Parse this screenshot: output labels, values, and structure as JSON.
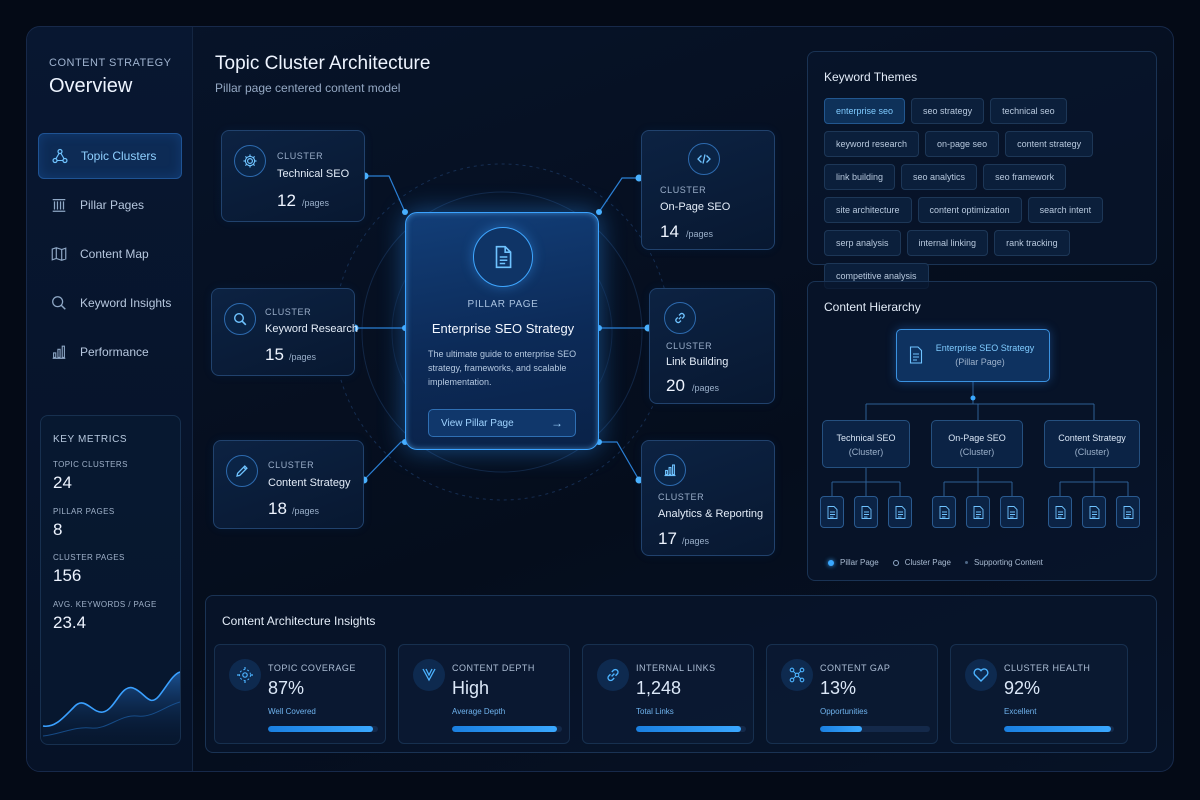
{
  "sidebar": {
    "kicker": "CONTENT STRATEGY",
    "title": "Overview",
    "nav": [
      {
        "label": "Topic Clusters",
        "icon": "hub-icon",
        "active": true
      },
      {
        "label": "Pillar Pages",
        "icon": "pillar-icon",
        "active": false
      },
      {
        "label": "Content Map",
        "icon": "map-icon",
        "active": false
      },
      {
        "label": "Keyword Insights",
        "icon": "search-icon",
        "active": false
      },
      {
        "label": "Performance",
        "icon": "bar-chart-icon",
        "active": false
      }
    ],
    "metrics": {
      "title": "KEY METRICS",
      "items": [
        {
          "label": "TOPIC CLUSTERS",
          "value": "24"
        },
        {
          "label": "PILLAR PAGES",
          "value": "8"
        },
        {
          "label": "CLUSTER PAGES",
          "value": "156"
        },
        {
          "label": "AVG. KEYWORDS / PAGE",
          "value": "23.4"
        }
      ]
    }
  },
  "header": {
    "title": "Topic Cluster Architecture",
    "subtitle": "Pillar page centered content model"
  },
  "pillar": {
    "kicker": "PILLAR PAGE",
    "title": "Enterprise SEO Strategy",
    "description": "The ultimate guide to enterprise SEO strategy, frameworks, and scalable implementation.",
    "button_label": "View Pillar Page",
    "button_arrow": "→"
  },
  "clusters": [
    {
      "kicker": "CLUSTER",
      "name": "Technical SEO",
      "pages": "12",
      "unit": "/pages",
      "icon": "gear-icon"
    },
    {
      "kicker": "CLUSTER",
      "name": "Keyword Research",
      "pages": "15",
      "unit": "/pages",
      "icon": "search-icon"
    },
    {
      "kicker": "CLUSTER",
      "name": "Content Strategy",
      "pages": "18",
      "unit": "/pages",
      "icon": "pencil-icon"
    },
    {
      "kicker": "CLUSTER",
      "name": "On-Page SEO",
      "pages": "14",
      "unit": "/pages",
      "icon": "code-icon"
    },
    {
      "kicker": "CLUSTER",
      "name": "Link Building",
      "pages": "20",
      "unit": "/pages",
      "icon": "link-icon"
    },
    {
      "kicker": "CLUSTER",
      "name": "Analytics & Reporting",
      "pages": "17",
      "unit": "/pages",
      "icon": "analytics-icon"
    }
  ],
  "keyword_themes": {
    "title": "Keyword Themes",
    "tags": [
      {
        "label": "enterprise seo",
        "active": true
      },
      {
        "label": "seo strategy",
        "active": false
      },
      {
        "label": "technical seo",
        "active": false
      },
      {
        "label": "keyword research",
        "active": false
      },
      {
        "label": "on-page seo",
        "active": false
      },
      {
        "label": "content strategy",
        "active": false
      },
      {
        "label": "link building",
        "active": false
      },
      {
        "label": "seo analytics",
        "active": false
      },
      {
        "label": "seo framework",
        "active": false
      },
      {
        "label": "site architecture",
        "active": false
      },
      {
        "label": "content optimization",
        "active": false
      },
      {
        "label": "search intent",
        "active": false
      },
      {
        "label": "serp analysis",
        "active": false
      },
      {
        "label": "internal linking",
        "active": false
      },
      {
        "label": "rank tracking",
        "active": false
      },
      {
        "label": "competitive analysis",
        "active": false
      }
    ]
  },
  "hierarchy": {
    "title": "Content Hierarchy",
    "root": {
      "name": "Enterprise SEO Strategy",
      "sub": "(Pillar Page)"
    },
    "children": [
      {
        "name": "Technical SEO",
        "sub": "(Cluster)"
      },
      {
        "name": "On-Page SEO",
        "sub": "(Cluster)"
      },
      {
        "name": "Content Strategy",
        "sub": "(Cluster)"
      }
    ],
    "legend": [
      "Pillar Page",
      "Cluster Page",
      "Supporting Content"
    ]
  },
  "insights": {
    "title": "Content Architecture Insights",
    "cards": [
      {
        "label": "TOPIC COVERAGE",
        "value": "87%",
        "sub": "Well Covered",
        "progress": 0.95,
        "icon": "target-icon"
      },
      {
        "label": "CONTENT DEPTH",
        "value": "High",
        "sub": "Average Depth",
        "progress": 0.95,
        "icon": "depth-icon"
      },
      {
        "label": "INTERNAL LINKS",
        "value": "1,248",
        "sub": "Total Links",
        "progress": 0.95,
        "icon": "link-icon"
      },
      {
        "label": "CONTENT GAP",
        "value": "13%",
        "sub": "Opportunities",
        "progress": 0.38,
        "icon": "gap-icon"
      },
      {
        "label": "CLUSTER HEALTH",
        "value": "92%",
        "sub": "Excellent",
        "progress": 0.97,
        "icon": "heart-icon"
      }
    ]
  },
  "colors": {
    "accent": "#3aa8ff",
    "background": "#040a16",
    "card": "#0c2242"
  }
}
